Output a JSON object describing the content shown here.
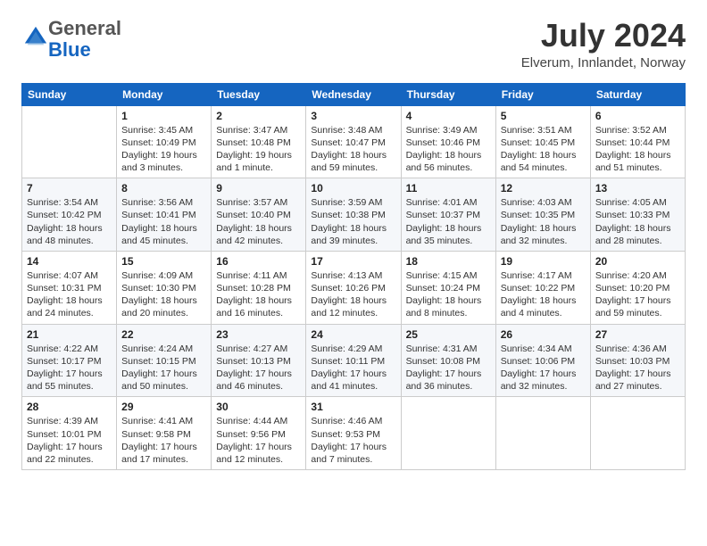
{
  "logo": {
    "general": "General",
    "blue": "Blue"
  },
  "header": {
    "month": "July 2024",
    "location": "Elverum, Innlandet, Norway"
  },
  "weekdays": [
    "Sunday",
    "Monday",
    "Tuesday",
    "Wednesday",
    "Thursday",
    "Friday",
    "Saturday"
  ],
  "weeks": [
    [
      {
        "day": "",
        "info": ""
      },
      {
        "day": "1",
        "info": "Sunrise: 3:45 AM\nSunset: 10:49 PM\nDaylight: 19 hours\nand 3 minutes."
      },
      {
        "day": "2",
        "info": "Sunrise: 3:47 AM\nSunset: 10:48 PM\nDaylight: 19 hours\nand 1 minute."
      },
      {
        "day": "3",
        "info": "Sunrise: 3:48 AM\nSunset: 10:47 PM\nDaylight: 18 hours\nand 59 minutes."
      },
      {
        "day": "4",
        "info": "Sunrise: 3:49 AM\nSunset: 10:46 PM\nDaylight: 18 hours\nand 56 minutes."
      },
      {
        "day": "5",
        "info": "Sunrise: 3:51 AM\nSunset: 10:45 PM\nDaylight: 18 hours\nand 54 minutes."
      },
      {
        "day": "6",
        "info": "Sunrise: 3:52 AM\nSunset: 10:44 PM\nDaylight: 18 hours\nand 51 minutes."
      }
    ],
    [
      {
        "day": "7",
        "info": "Sunrise: 3:54 AM\nSunset: 10:42 PM\nDaylight: 18 hours\nand 48 minutes."
      },
      {
        "day": "8",
        "info": "Sunrise: 3:56 AM\nSunset: 10:41 PM\nDaylight: 18 hours\nand 45 minutes."
      },
      {
        "day": "9",
        "info": "Sunrise: 3:57 AM\nSunset: 10:40 PM\nDaylight: 18 hours\nand 42 minutes."
      },
      {
        "day": "10",
        "info": "Sunrise: 3:59 AM\nSunset: 10:38 PM\nDaylight: 18 hours\nand 39 minutes."
      },
      {
        "day": "11",
        "info": "Sunrise: 4:01 AM\nSunset: 10:37 PM\nDaylight: 18 hours\nand 35 minutes."
      },
      {
        "day": "12",
        "info": "Sunrise: 4:03 AM\nSunset: 10:35 PM\nDaylight: 18 hours\nand 32 minutes."
      },
      {
        "day": "13",
        "info": "Sunrise: 4:05 AM\nSunset: 10:33 PM\nDaylight: 18 hours\nand 28 minutes."
      }
    ],
    [
      {
        "day": "14",
        "info": "Sunrise: 4:07 AM\nSunset: 10:31 PM\nDaylight: 18 hours\nand 24 minutes."
      },
      {
        "day": "15",
        "info": "Sunrise: 4:09 AM\nSunset: 10:30 PM\nDaylight: 18 hours\nand 20 minutes."
      },
      {
        "day": "16",
        "info": "Sunrise: 4:11 AM\nSunset: 10:28 PM\nDaylight: 18 hours\nand 16 minutes."
      },
      {
        "day": "17",
        "info": "Sunrise: 4:13 AM\nSunset: 10:26 PM\nDaylight: 18 hours\nand 12 minutes."
      },
      {
        "day": "18",
        "info": "Sunrise: 4:15 AM\nSunset: 10:24 PM\nDaylight: 18 hours\nand 8 minutes."
      },
      {
        "day": "19",
        "info": "Sunrise: 4:17 AM\nSunset: 10:22 PM\nDaylight: 18 hours\nand 4 minutes."
      },
      {
        "day": "20",
        "info": "Sunrise: 4:20 AM\nSunset: 10:20 PM\nDaylight: 17 hours\nand 59 minutes."
      }
    ],
    [
      {
        "day": "21",
        "info": "Sunrise: 4:22 AM\nSunset: 10:17 PM\nDaylight: 17 hours\nand 55 minutes."
      },
      {
        "day": "22",
        "info": "Sunrise: 4:24 AM\nSunset: 10:15 PM\nDaylight: 17 hours\nand 50 minutes."
      },
      {
        "day": "23",
        "info": "Sunrise: 4:27 AM\nSunset: 10:13 PM\nDaylight: 17 hours\nand 46 minutes."
      },
      {
        "day": "24",
        "info": "Sunrise: 4:29 AM\nSunset: 10:11 PM\nDaylight: 17 hours\nand 41 minutes."
      },
      {
        "day": "25",
        "info": "Sunrise: 4:31 AM\nSunset: 10:08 PM\nDaylight: 17 hours\nand 36 minutes."
      },
      {
        "day": "26",
        "info": "Sunrise: 4:34 AM\nSunset: 10:06 PM\nDaylight: 17 hours\nand 32 minutes."
      },
      {
        "day": "27",
        "info": "Sunrise: 4:36 AM\nSunset: 10:03 PM\nDaylight: 17 hours\nand 27 minutes."
      }
    ],
    [
      {
        "day": "28",
        "info": "Sunrise: 4:39 AM\nSunset: 10:01 PM\nDaylight: 17 hours\nand 22 minutes."
      },
      {
        "day": "29",
        "info": "Sunrise: 4:41 AM\nSunset: 9:58 PM\nDaylight: 17 hours\nand 17 minutes."
      },
      {
        "day": "30",
        "info": "Sunrise: 4:44 AM\nSunset: 9:56 PM\nDaylight: 17 hours\nand 12 minutes."
      },
      {
        "day": "31",
        "info": "Sunrise: 4:46 AM\nSunset: 9:53 PM\nDaylight: 17 hours\nand 7 minutes."
      },
      {
        "day": "",
        "info": ""
      },
      {
        "day": "",
        "info": ""
      },
      {
        "day": "",
        "info": ""
      }
    ]
  ]
}
